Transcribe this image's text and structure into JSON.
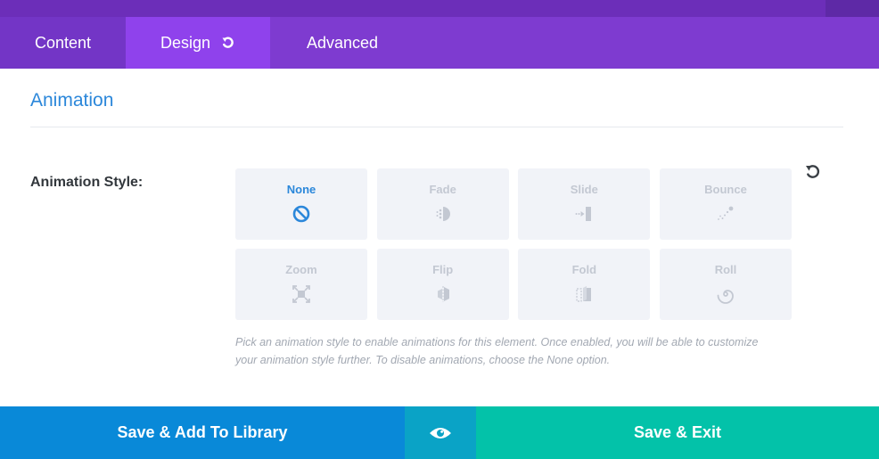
{
  "tabs": [
    {
      "label": "Content"
    },
    {
      "label": "Design"
    },
    {
      "label": "Advanced"
    }
  ],
  "active_tab": "Design",
  "section": {
    "title": "Animation"
  },
  "field": {
    "label": "Animation Style:",
    "options": [
      {
        "label": "None",
        "icon": "none-icon"
      },
      {
        "label": "Fade",
        "icon": "fade-icon"
      },
      {
        "label": "Slide",
        "icon": "slide-icon"
      },
      {
        "label": "Bounce",
        "icon": "bounce-icon"
      },
      {
        "label": "Zoom",
        "icon": "zoom-icon"
      },
      {
        "label": "Flip",
        "icon": "flip-icon"
      },
      {
        "label": "Fold",
        "icon": "fold-icon"
      },
      {
        "label": "Roll",
        "icon": "roll-icon"
      }
    ],
    "selected": "None",
    "help": "Pick an animation style to enable animations for this element. Once enabled, you will be able to customize your animation style further. To disable animations, choose the None option."
  },
  "footer": {
    "save_library": "Save & Add To Library",
    "save_exit": "Save & Exit"
  },
  "colors": {
    "tab_bar": "#7e3bd0",
    "active_tab": "#8f42ec",
    "accent_blue": "#2b87da",
    "library_button": "#0989d8",
    "preview_button": "#0aa3c6",
    "exit_button": "#03c2a9"
  }
}
